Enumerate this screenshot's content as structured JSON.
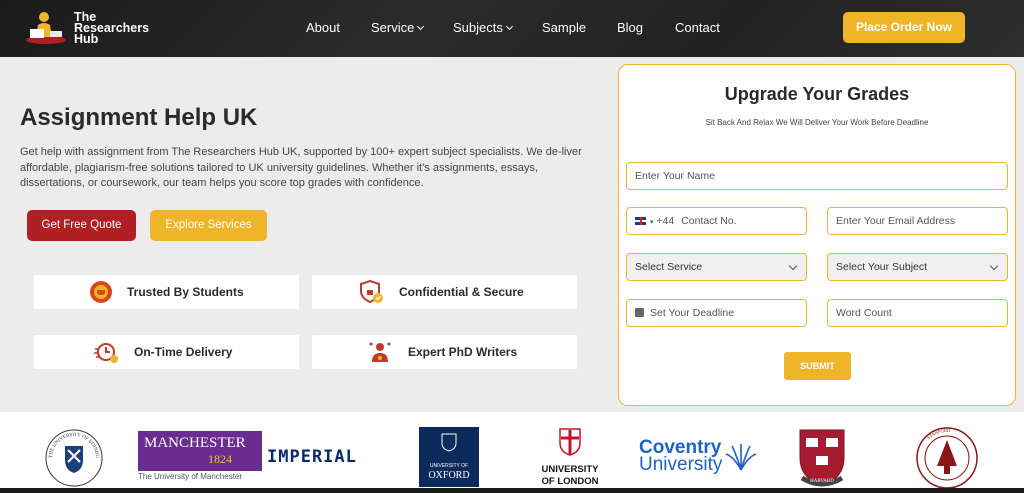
{
  "brand": {
    "name_line1": "The",
    "name_line2": "Researchers",
    "name_line3": "Hub"
  },
  "nav": {
    "about": "About",
    "service": "Service",
    "subjects": "Subjects",
    "sample": "Sample",
    "blog": "Blog",
    "contact": "Contact",
    "cta": "Place Order Now"
  },
  "hero": {
    "title": "Assignment Help UK",
    "description": "Get help with assignment from The Researchers Hub UK, supported by 100+ expert subject specialists. We de-liver affordable, plagiarism-free solutions tailored to UK university guidelines. Whether it’s assignments, essays, dissertations, or coursework, our team helps you score top grades with confidence.",
    "btn_quote": "Get Free Quote",
    "btn_explore": "Explore Services"
  },
  "features": [
    {
      "label": "Trusted By Students",
      "icon": "trophy-badge-icon"
    },
    {
      "label": "Confidential & Secure",
      "icon": "shield-check-icon"
    },
    {
      "label": "On-Time Delivery",
      "icon": "clock-delivery-icon"
    },
    {
      "label": "Expert PhD Writers",
      "icon": "expert-writer-icon"
    }
  ],
  "form": {
    "title": "Upgrade Your Grades",
    "subtitle": "Sit Back And Relax We Will Deliver Your Work Before Deadline",
    "name_placeholder": "Enter Your Name",
    "country_code": "+44",
    "phone_placeholder": "Contact No.",
    "email_placeholder": "Enter Your Email Address",
    "service_select": "Select Service",
    "subject_select": "Select Your Subject",
    "deadline_placeholder": "Set Your Deadline",
    "wordcount_placeholder": "Word Count",
    "submit": "SUBMIT"
  },
  "logos": {
    "edinburgh": "THE UNIVERSITY OF EDINBURGH",
    "manchester_main": "MANCHESTER",
    "manchester_year": "1824",
    "manchester_sub": "The University of Manchester",
    "imperial": "IMPERIAL",
    "oxford_line1": "UNIVERSITY OF",
    "oxford_line2": "OXFORD",
    "london_line1": "UNIVERSITY",
    "london_line2": "OF LONDON",
    "coventry_line1": "Coventry",
    "coventry_line2": "University",
    "harvard": "HARVARD",
    "stanford": "STANFORD"
  },
  "colors": {
    "accent": "#f0b429",
    "primary_red": "#b01f24",
    "dark": "#222222"
  }
}
